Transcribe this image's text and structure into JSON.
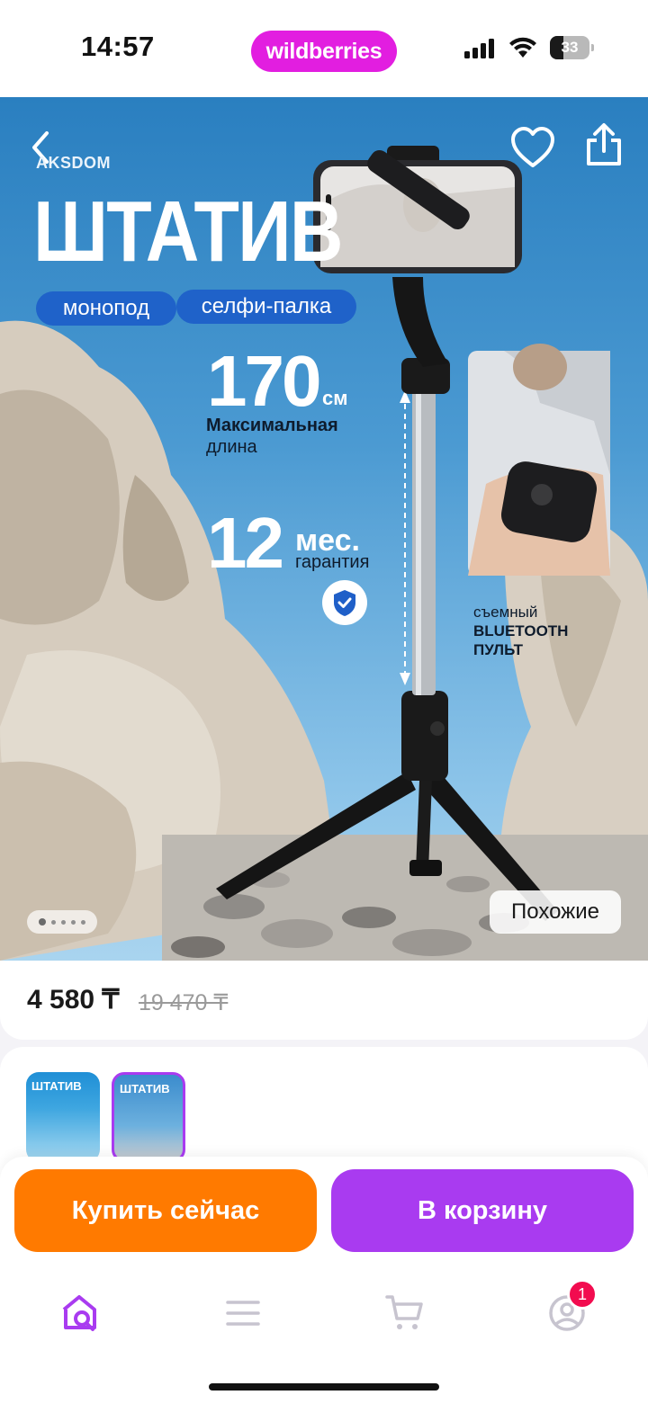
{
  "status_bar": {
    "time": "14:57",
    "brand": "wildberries",
    "battery_level": "33",
    "icons": [
      "signal-icon",
      "wifi-icon",
      "battery-icon"
    ]
  },
  "hero": {
    "logo": "AKSDOM",
    "title": "ШТАТИВ",
    "tags": [
      "монопод",
      "селфи-палка"
    ],
    "spec_length_value": "170",
    "spec_length_unit": "см",
    "spec_length_label_1": "Максимальная",
    "spec_length_label_2": "длина",
    "spec_warranty_value": "12",
    "spec_warranty_unit": "мес.",
    "spec_warranty_label": "гарантия",
    "remote_line_1": "съемный",
    "remote_line_2": "BLUETOOTH",
    "remote_line_3": "ПУЛЬТ",
    "similar_label": "Похожие",
    "slide_count": 5,
    "active_slide": 1,
    "icons": [
      "back-icon",
      "heart-icon",
      "share-icon",
      "shield-check-icon"
    ]
  },
  "price": {
    "current": "4 580 ₸",
    "old": "19 470 ₸"
  },
  "thumbnails": [
    {
      "label": "ШТАТИВ",
      "selected": false
    },
    {
      "label": "ШТАТИВ",
      "selected": true
    }
  ],
  "actions": {
    "buy_now": "Купить сейчас",
    "add_to_cart": "В корзину"
  },
  "tabbar": {
    "items": [
      "home-search-icon",
      "menu-icon",
      "cart-icon",
      "profile-icon"
    ],
    "profile_badge": "1"
  },
  "colors": {
    "brand": "#e21ee0",
    "buy": "#ff7a00",
    "cart": "#a93bf0",
    "badge": "#f20c4f"
  }
}
